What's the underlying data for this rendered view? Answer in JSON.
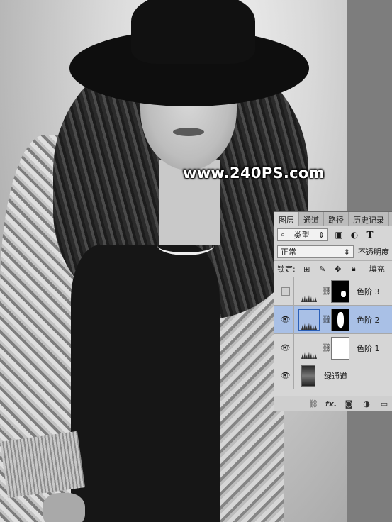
{
  "canvas": {
    "watermark": "www.240PS.com"
  },
  "layers_panel": {
    "tabs": [
      {
        "label": "图层"
      },
      {
        "label": "通道"
      },
      {
        "label": "路径"
      },
      {
        "label": "历史记录"
      }
    ],
    "filter": {
      "value": "类型",
      "icons": [
        "image-filter-icon",
        "adjustment-filter-icon",
        "type-filter-icon"
      ]
    },
    "blend_mode": {
      "value": "正常",
      "opacity_label": "不透明度"
    },
    "lock": {
      "label": "锁定:",
      "fill_label": "填充"
    },
    "layers": [
      {
        "name": "色阶 3",
        "visible": false,
        "selected": false,
        "mask": "black-with-spot"
      },
      {
        "name": "色阶 2",
        "visible": true,
        "selected": true,
        "mask": "black-with-figure"
      },
      {
        "name": "色阶 1",
        "visible": true,
        "selected": false,
        "mask": "white"
      },
      {
        "name": "绿通道",
        "visible": true,
        "selected": false,
        "mask": "photo"
      }
    ],
    "footer_icons": [
      "link-icon",
      "fx-icon",
      "add-mask-icon",
      "adjustment-layer-icon",
      "new-group-icon"
    ],
    "footer_fx_label": "fx."
  }
}
